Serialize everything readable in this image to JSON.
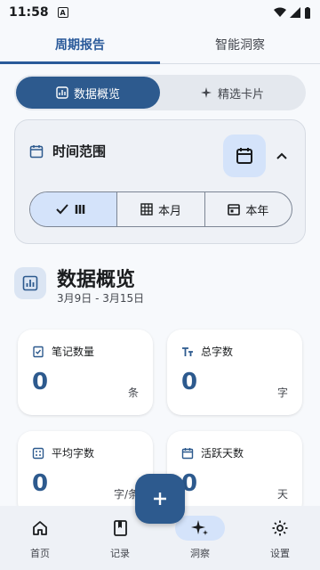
{
  "status_bar": {
    "time": "11:58",
    "badge": "A"
  },
  "tabs": [
    {
      "label": "周期报告",
      "active": true
    },
    {
      "label": "智能洞察",
      "active": false
    }
  ],
  "view_switch": [
    {
      "label": "数据概览",
      "active": true,
      "icon": "chart-icon"
    },
    {
      "label": "精选卡片",
      "active": false,
      "icon": "sparkle-icon"
    }
  ],
  "time_range": {
    "title": "时间范围",
    "options": [
      {
        "label": "",
        "icon": "week-icon",
        "active": true
      },
      {
        "label": "本月",
        "icon": "grid-icon",
        "active": false
      },
      {
        "label": "本年",
        "icon": "calendar-icon",
        "active": false
      }
    ]
  },
  "overview": {
    "title": "数据概览",
    "date_range": "3月9日 - 3月15日"
  },
  "stats": [
    {
      "label": "笔记数量",
      "value": "0",
      "unit": "条",
      "icon": "note-icon"
    },
    {
      "label": "总字数",
      "value": "0",
      "unit": "字",
      "icon": "text-icon"
    },
    {
      "label": "平均字数",
      "value": "0",
      "unit": "字/条",
      "icon": "calc-icon"
    },
    {
      "label": "活跃天数",
      "value": "0",
      "unit": "天",
      "icon": "calendar-icon"
    }
  ],
  "bottom_nav": [
    {
      "label": "首页",
      "icon": "home-icon",
      "active": false
    },
    {
      "label": "记录",
      "icon": "book-icon",
      "active": false
    },
    {
      "label": "洞察",
      "icon": "sparkle-icon",
      "active": true
    },
    {
      "label": "设置",
      "icon": "gear-icon",
      "active": false
    }
  ],
  "colors": {
    "primary": "#2d5a8e",
    "primary_container": "#d4e3fa",
    "surface": "#f7f9fc"
  }
}
